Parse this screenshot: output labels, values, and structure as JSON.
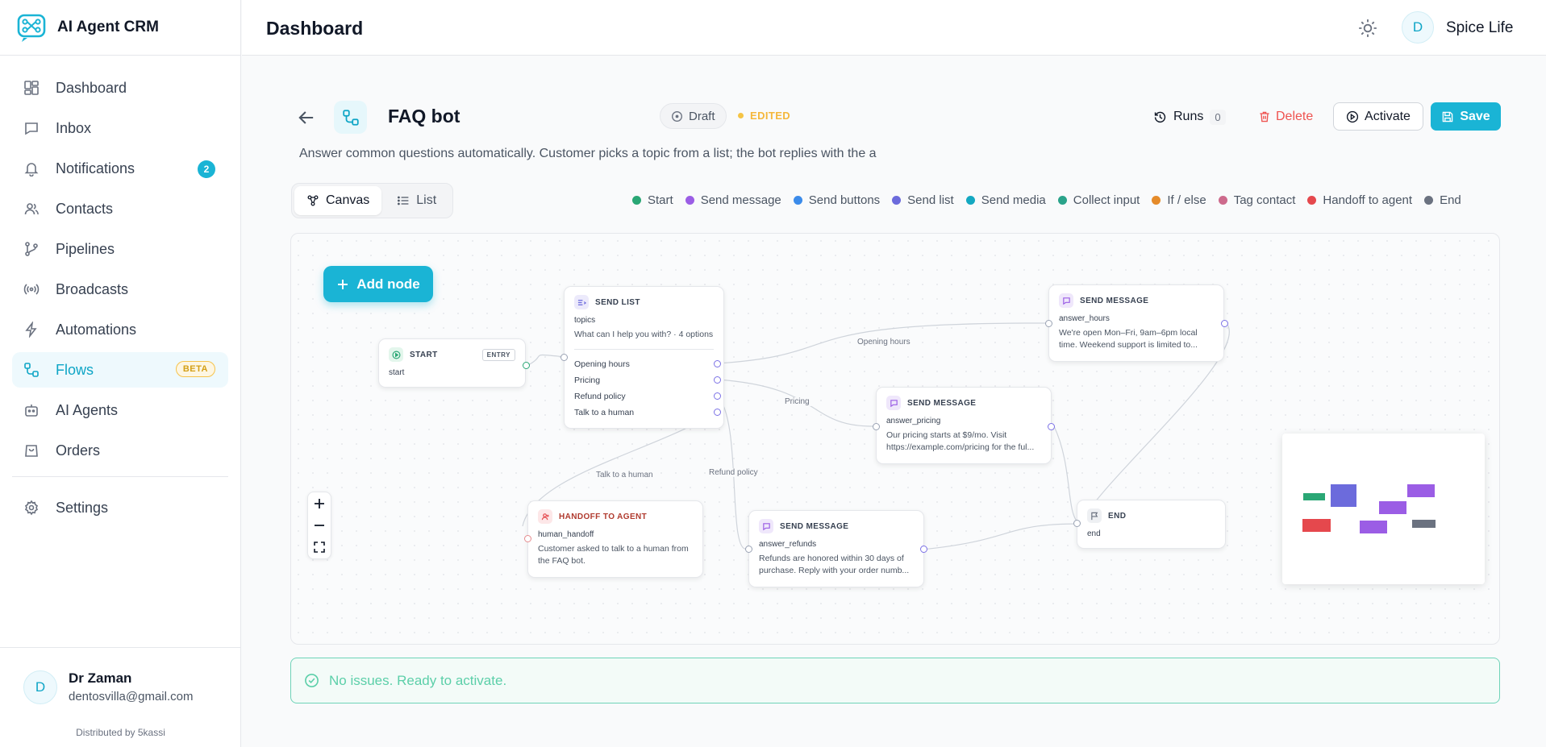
{
  "app": {
    "name": "AI Agent CRM",
    "distributed_by": "Distributed by 5kassi"
  },
  "sidebar": {
    "items": [
      {
        "label": "Dashboard",
        "icon": "dashboard-icon"
      },
      {
        "label": "Inbox",
        "icon": "inbox-icon"
      },
      {
        "label": "Notifications",
        "icon": "bell-icon",
        "badge": "2"
      },
      {
        "label": "Contacts",
        "icon": "users-icon"
      },
      {
        "label": "Pipelines",
        "icon": "pipeline-icon"
      },
      {
        "label": "Broadcasts",
        "icon": "broadcast-icon"
      },
      {
        "label": "Automations",
        "icon": "bolt-icon"
      },
      {
        "label": "Flows",
        "icon": "flow-icon",
        "badge": "BETA",
        "active": true
      },
      {
        "label": "AI Agents",
        "icon": "bot-icon"
      },
      {
        "label": "Orders",
        "icon": "bag-icon"
      }
    ],
    "settings": "Settings"
  },
  "user": {
    "initial": "D",
    "name": "Dr Zaman",
    "email": "dentosvilla@gmail.com"
  },
  "topbar": {
    "title": "Dashboard",
    "workspace_initial": "D",
    "workspace": "Spice Life"
  },
  "flow": {
    "title": "FAQ bot",
    "status": "Draft",
    "edited": "EDITED",
    "runs_label": "Runs",
    "runs_count": "0",
    "delete_label": "Delete",
    "activate_label": "Activate",
    "save_label": "Save",
    "description": "Answer common questions automatically. Customer picks a topic from a list; the bot replies with the a"
  },
  "view": {
    "canvas": "Canvas",
    "list": "List"
  },
  "legend": [
    {
      "label": "Start",
      "color": "#2aa775"
    },
    {
      "label": "Send message",
      "color": "#9b5de5"
    },
    {
      "label": "Send buttons",
      "color": "#3b8bea"
    },
    {
      "label": "Send list",
      "color": "#6c6bdc"
    },
    {
      "label": "Send media",
      "color": "#14a8c1"
    },
    {
      "label": "Collect input",
      "color": "#2aa38a"
    },
    {
      "label": "If / else",
      "color": "#e58b2a"
    },
    {
      "label": "Tag contact",
      "color": "#cd6a8c"
    },
    {
      "label": "Handoff to agent",
      "color": "#e5484d"
    },
    {
      "label": "End",
      "color": "#6b7280"
    }
  ],
  "canvas": {
    "add_node": "Add node",
    "nodes": {
      "start": {
        "type": "START",
        "tag": "ENTRY",
        "key": "start"
      },
      "list": {
        "type": "SEND LIST",
        "key": "topics",
        "body": "What can I help you with? · 4 options",
        "options": [
          "Opening hours",
          "Pricing",
          "Refund policy",
          "Talk to a human"
        ]
      },
      "hours": {
        "type": "SEND MESSAGE",
        "key": "answer_hours",
        "body": "We're open Mon–Fri, 9am–6pm local time. Weekend support is limited to..."
      },
      "pricing": {
        "type": "SEND MESSAGE",
        "key": "answer_pricing",
        "body": "Our pricing starts at $9/mo. Visit https://example.com/pricing for the ful..."
      },
      "handoff": {
        "type": "HANDOFF TO AGENT",
        "key": "human_handoff",
        "body": "Customer asked to talk to a human from the FAQ bot."
      },
      "refunds": {
        "type": "SEND MESSAGE",
        "key": "answer_refunds",
        "body": "Refunds are honored within 30 days of purchase. Reply with your order numb..."
      },
      "end": {
        "type": "END",
        "key": "end"
      }
    },
    "edge_labels": {
      "hours": "Opening hours",
      "pricing": "Pricing",
      "refund": "Refund policy",
      "human": "Talk to a human"
    }
  },
  "status_message": "No issues. Ready to activate."
}
